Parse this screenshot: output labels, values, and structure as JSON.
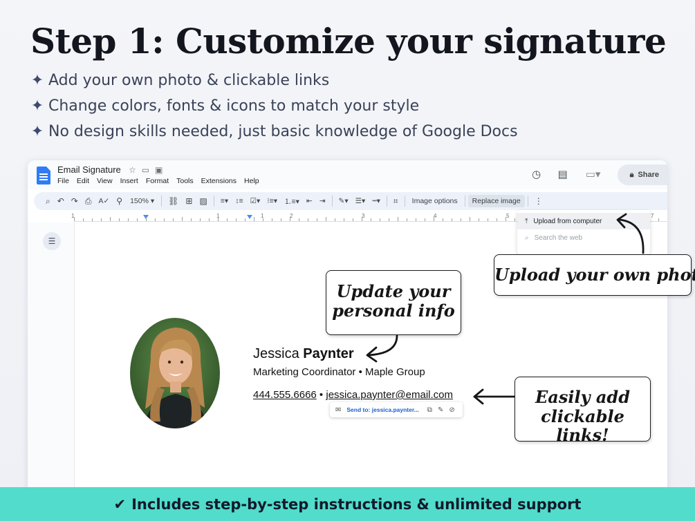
{
  "headline": "Step 1: Customize your signature",
  "bullets": [
    "Add your own photo & clickable links",
    "Change colors, fonts & icons to match your style",
    "No design skills needed, just basic knowledge of Google Docs"
  ],
  "docs": {
    "title": "Email Signature",
    "menus": [
      "File",
      "Edit",
      "View",
      "Insert",
      "Format",
      "Tools",
      "Extensions",
      "Help"
    ],
    "share_label": "Share",
    "toolbar": {
      "zoom": "150%",
      "image_options": "Image options",
      "replace_image": "Replace image"
    },
    "ruler_numbers": [
      "1",
      "1",
      "1",
      "2",
      "3",
      "4",
      "5",
      "7"
    ],
    "dropdown": {
      "upload": "Upload from computer",
      "search_web": "Search the web"
    },
    "signature": {
      "first_name": "Jessica",
      "last_name": "Paynter",
      "job_title": "Marketing Coordinator • Maple Group",
      "phone": "444.555.6666",
      "separator": " • ",
      "email": "jessica.paynter@email.com"
    },
    "link_popup": "Send to: jessica.paynter..."
  },
  "callouts": {
    "upload_photo": "Upload your own photo",
    "update_info_line1": "Update your",
    "update_info_line2": "personal info",
    "links_line1": "Easily add",
    "links_line2": "clickable links!"
  },
  "footer": {
    "check": "✔",
    "text": "Includes step-by-step instructions & unlimited support"
  },
  "colors": {
    "footer_bg": "#52dccb",
    "docs_blue": "#2f7cf6",
    "toolbar_bg": "#edf2fa"
  }
}
